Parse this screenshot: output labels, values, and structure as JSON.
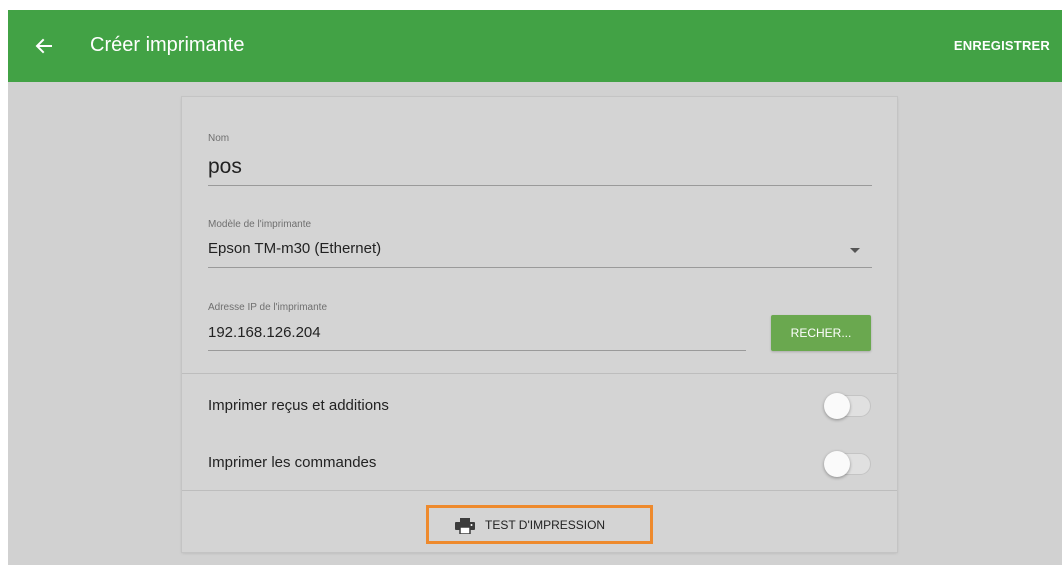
{
  "header": {
    "title": "Créer imprimante",
    "back_icon": "arrow-left-icon",
    "save_label": "ENREGISTRER",
    "color": "#42a245"
  },
  "form": {
    "name": {
      "label": "Nom",
      "value": "pos"
    },
    "model": {
      "label": "Modèle de l'imprimante",
      "value": "Epson TM-m30 (Ethernet)"
    },
    "ip": {
      "label": "Adresse IP de l'imprimante",
      "value": "192.168.126.204",
      "search_label": "RECHER..."
    }
  },
  "toggles": [
    {
      "label": "Imprimer reçus et additions",
      "enabled": false
    },
    {
      "label": "Imprimer les commandes",
      "enabled": false
    }
  ],
  "footer": {
    "test_label": "TEST D'IMPRESSION",
    "icon": "printer-icon",
    "highlight_color": "#ee8a2d"
  }
}
